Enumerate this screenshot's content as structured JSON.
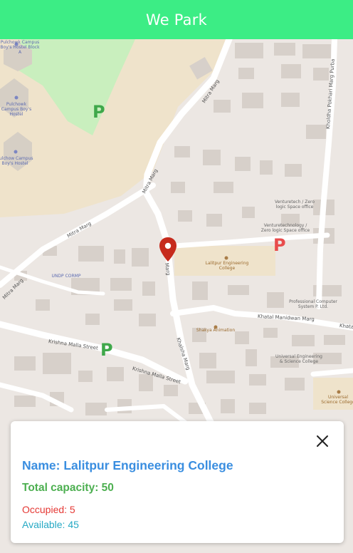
{
  "app_bar": {
    "title": "We Park",
    "color": "#3ced85"
  },
  "map": {
    "roads": [
      "Mitra Marg",
      "Mitra Marg",
      "Mitra Marg",
      "Mitra Marg",
      "Krishna Malla Street",
      "Krishna Malla Street",
      "Khalsha Marg",
      "Marg",
      "Khatal Manidwan Marg",
      "Khatal",
      "Kholdha Pokhari Marg Purba"
    ],
    "places": [
      "Pulchowk Campus Boy's Hostel Block A",
      "Pulchowk Campus Boy's Hostel",
      "Pulchow Campus Boy's Hostel",
      "Venturetech / Zero logic Space office",
      "Venturetechnology / Zero logic Space office",
      "Lalitpur Engineering College",
      "UNDP CORMP",
      "Professional Computer System P. Ltd.",
      "Shakya Animation",
      "Universal Engineering & Science College",
      "Universal Science College"
    ],
    "parking_markers": [
      {
        "icon": "parking-icon",
        "status_color": "#3fa84a"
      },
      {
        "icon": "parking-icon",
        "status_color": "#e84c4c"
      },
      {
        "icon": "parking-icon",
        "status_color": "#3fa84a"
      }
    ],
    "selected_pin": {
      "icon": "map-pin-icon",
      "color": "#c62b1d"
    }
  },
  "info_card": {
    "close_icon": "close-icon",
    "name": "Name: Lalitpur Engineering College",
    "capacity": "Total capacity: 50",
    "occupied": "Occupied: 5",
    "available": "Available: 45"
  }
}
